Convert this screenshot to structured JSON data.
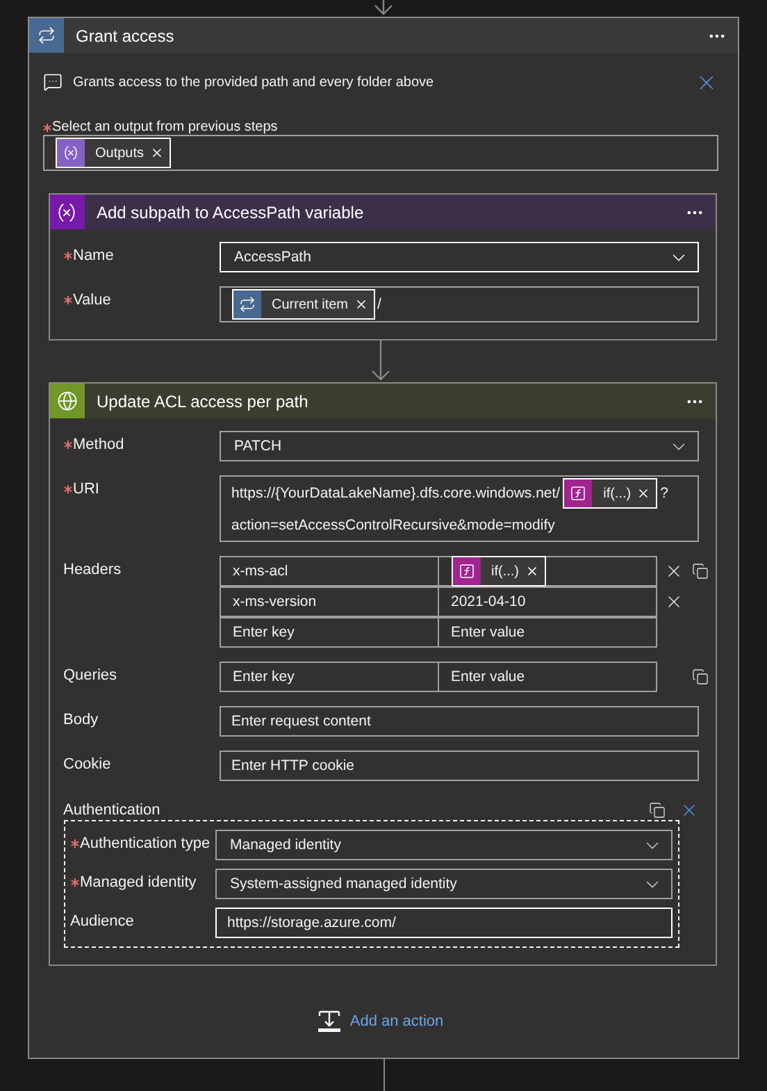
{
  "scope": {
    "title": "Grant access",
    "comment": "Grants access to the provided path and every folder above",
    "output": {
      "label": "Select an output from previous steps",
      "required": true,
      "parts": [
        {
          "kind": "variable",
          "label": "Outputs"
        }
      ]
    }
  },
  "actions": [
    {
      "kind": "variable",
      "title": "Add subpath to AccessPath variable",
      "fields": [
        {
          "kind": "select",
          "label": "Name",
          "required": true,
          "value": "AccessPath",
          "focused": true
        },
        {
          "kind": "tokens",
          "label": "Value",
          "required": true,
          "parts": [
            {
              "kind": "loop",
              "label": "Current item"
            },
            {
              "kind": "text",
              "text": "/"
            }
          ]
        }
      ]
    },
    {
      "kind": "http",
      "title": "Update ACL access per path",
      "fields": [
        {
          "kind": "select",
          "label": "Method",
          "required": true,
          "value": "PATCH",
          "focused": false
        },
        {
          "kind": "tokens",
          "label": "URI",
          "required": true,
          "parts": [
            {
              "kind": "text",
              "text": "https://{YourDataLakeName}.dfs.core.windows.net/"
            },
            {
              "kind": "expression",
              "label": "if(...)"
            },
            {
              "kind": "text",
              "text": "?"
            },
            {
              "kind": "text",
              "text": "action=setAccessControlRecursive&mode=modify"
            }
          ]
        },
        {
          "kind": "pairs",
          "label": "Headers",
          "required": false,
          "rows": [
            {
              "key": "x-ms-acl",
              "value": [
                {
                  "kind": "expression",
                  "label": "if(...)"
                }
              ]
            },
            {
              "key": "x-ms-version",
              "value": [
                {
                  "kind": "text",
                  "text": "2021-04-10"
                }
              ]
            }
          ],
          "key_placeholder": "Enter key",
          "value_placeholder": "Enter value"
        },
        {
          "kind": "pairs",
          "label": "Queries",
          "required": false,
          "key_placeholder": "Enter key",
          "value_placeholder": "Enter value"
        },
        {
          "kind": "text",
          "label": "Body",
          "required": false,
          "placeholder": "Enter request content",
          "focused": false
        },
        {
          "kind": "text",
          "label": "Cookie",
          "required": false,
          "placeholder": "Enter HTTP cookie",
          "focused": false
        },
        {
          "kind": "group",
          "label": "Authentication",
          "fields": [
            {
              "kind": "select",
              "label": "Authentication type",
              "required": true,
              "value": "Managed identity",
              "focused": false
            },
            {
              "kind": "select",
              "label": "Managed identity",
              "required": true,
              "value": "System-assigned managed identity",
              "focused": false
            },
            {
              "kind": "text",
              "label": "Audience",
              "required": false,
              "value": "https://storage.azure.com/",
              "focused": true
            }
          ]
        }
      ]
    }
  ],
  "add_action": "Add an action"
}
